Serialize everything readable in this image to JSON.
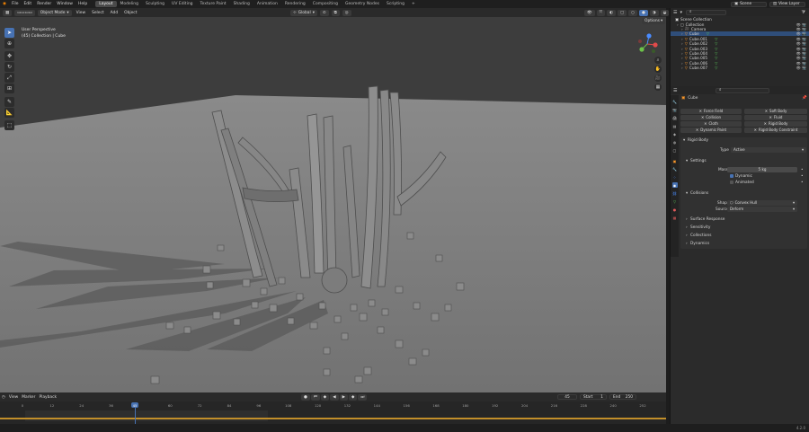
{
  "menu": [
    "File",
    "Edit",
    "Render",
    "Window",
    "Help"
  ],
  "workspaces": [
    "Layout",
    "Modeling",
    "Sculpting",
    "UV Editing",
    "Texture Paint",
    "Shading",
    "Animation",
    "Rendering",
    "Compositing",
    "Geometry Nodes",
    "Scripting"
  ],
  "active_workspace": "Layout",
  "scene": {
    "name": "Scene",
    "view_layer": "View Layer"
  },
  "viewport_header": {
    "mode": "Object Mode",
    "menus": [
      "View",
      "Select",
      "Add",
      "Object"
    ],
    "orientation": "Global",
    "options": "Options"
  },
  "viewport": {
    "perspective": "User Perspective",
    "collection_info": "(45) Collection | Cube"
  },
  "outliner": {
    "search_placeholder": "",
    "rows": [
      {
        "name": "Scene Collection",
        "kind": "scene"
      },
      {
        "name": "Collection",
        "kind": "collection"
      },
      {
        "name": "Camera",
        "kind": "camera"
      },
      {
        "name": "Cube",
        "kind": "mesh",
        "selected": true
      },
      {
        "name": "Cube.001",
        "kind": "mesh"
      },
      {
        "name": "Cube.002",
        "kind": "mesh"
      },
      {
        "name": "Cube.003",
        "kind": "mesh"
      },
      {
        "name": "Cube.004",
        "kind": "mesh"
      },
      {
        "name": "Cube.005",
        "kind": "mesh"
      },
      {
        "name": "Cube.006",
        "kind": "mesh"
      },
      {
        "name": "Cube.007",
        "kind": "mesh"
      }
    ]
  },
  "properties": {
    "object_name": "Cube",
    "physics_buttons": [
      "Force Field",
      "Soft Body",
      "Collision",
      "Fluid",
      "Cloth",
      "Rigid Body",
      "Dynamic Paint",
      "Rigid Body Constraint"
    ],
    "rigid_body": {
      "title": "Rigid Body",
      "type_label": "Type",
      "type_value": "Active",
      "settings_label": "Settings",
      "mass_label": "Mass",
      "mass_value": "5 kg",
      "dynamic_label": "Dynamic",
      "animated_label": "Animated",
      "collisions_label": "Collisions",
      "shape_label": "Shape",
      "shape_value": "Convex Hull",
      "source_label": "Source",
      "source_value": "Deform",
      "subpanels": [
        "Surface Response",
        "Sensitivity",
        "Collections",
        "Dynamics"
      ]
    }
  },
  "timeline": {
    "menus": [
      "View",
      "Marker",
      "Playback"
    ],
    "current_frame": "45",
    "start_label": "Start",
    "start_value": "1",
    "end_label": "End",
    "end_value": "250",
    "ticks": [
      "0",
      "12",
      "24",
      "36",
      "45",
      "60",
      "72",
      "84",
      "96",
      "108",
      "120",
      "132",
      "144",
      "156",
      "168",
      "180",
      "192",
      "204",
      "216",
      "228",
      "240",
      "252"
    ]
  },
  "version": "4.2.0",
  "colors": {
    "accent": "#4772b3",
    "orange": "#ff9a2a",
    "green_mesh": "#58c458"
  }
}
